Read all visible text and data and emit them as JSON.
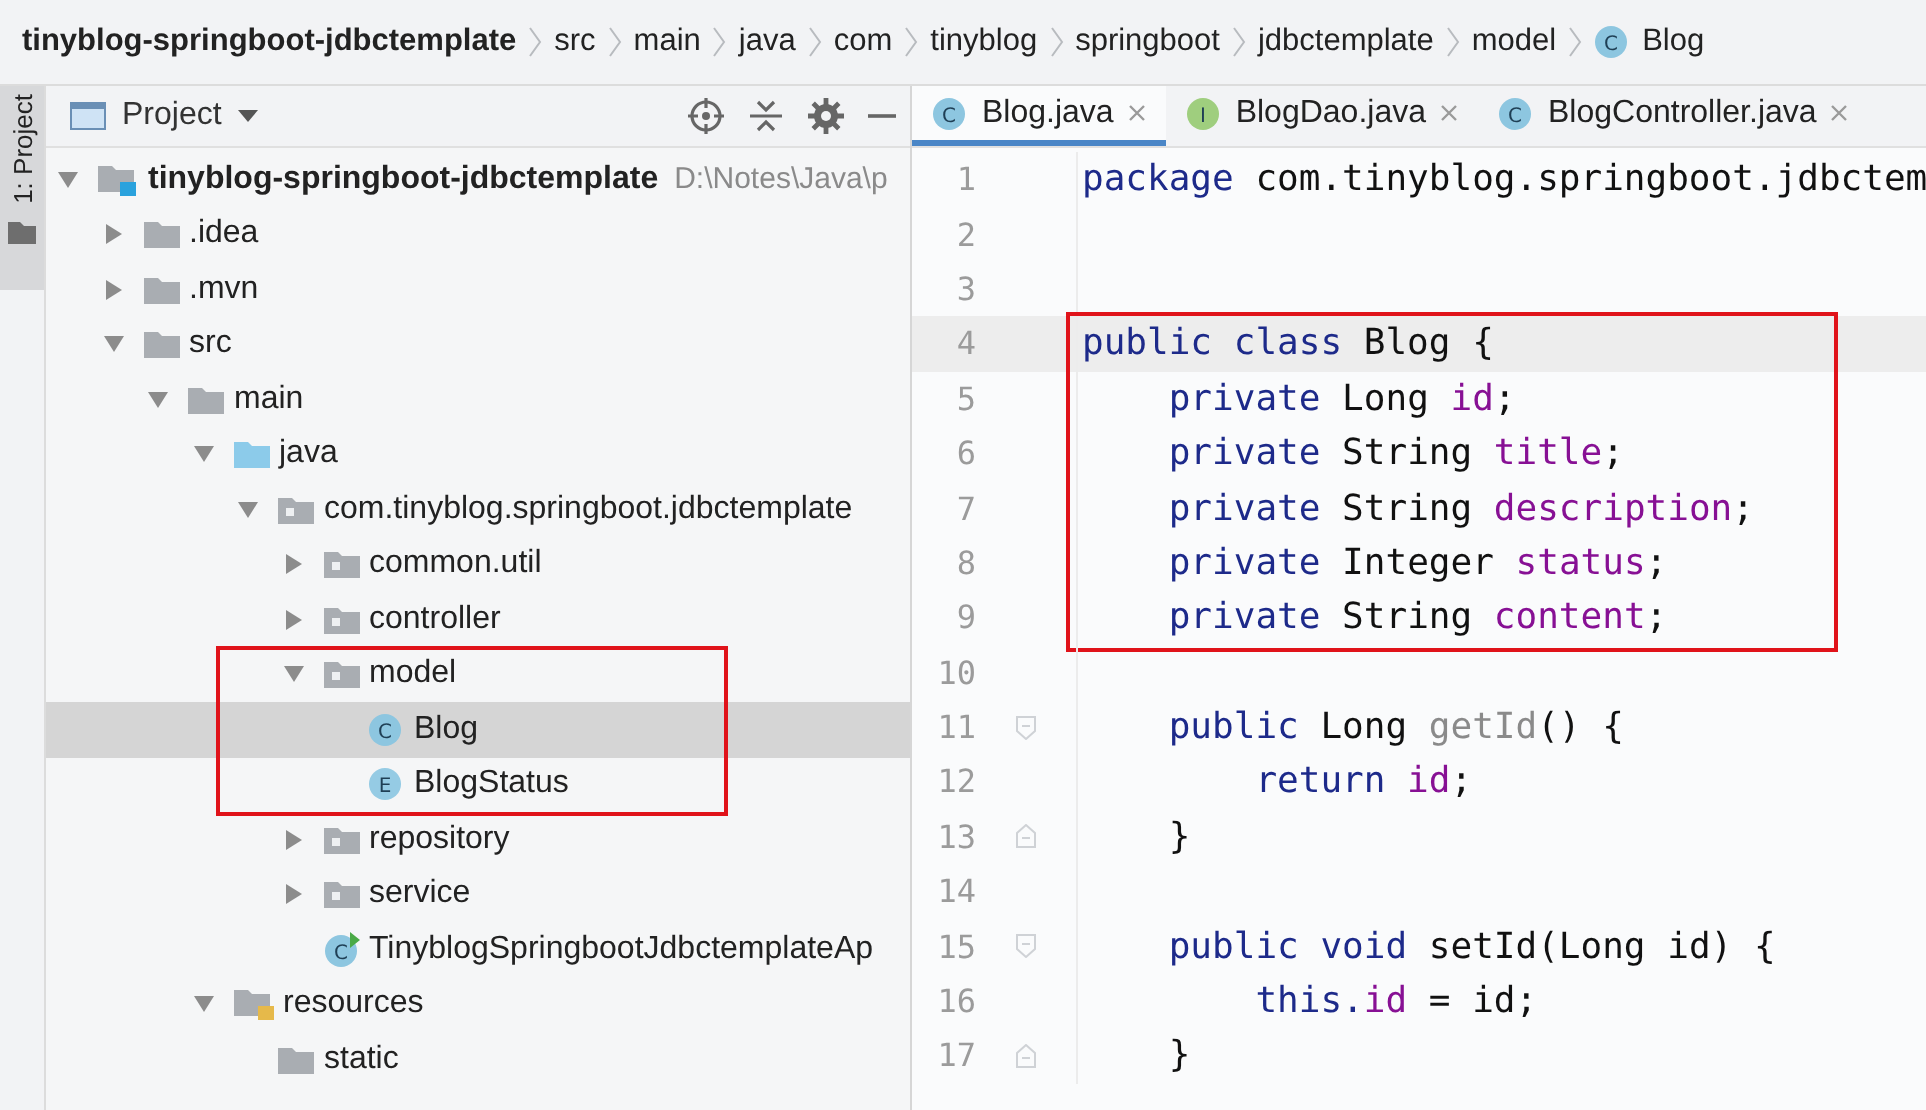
{
  "breadcrumb": [
    {
      "label": "tinyblog-springboot-jdbctemplate",
      "kind": "project"
    },
    {
      "label": "src",
      "kind": "folder"
    },
    {
      "label": "main",
      "kind": "folder"
    },
    {
      "label": "java",
      "kind": "folder"
    },
    {
      "label": "com",
      "kind": "folder"
    },
    {
      "label": "tinyblog",
      "kind": "folder"
    },
    {
      "label": "springboot",
      "kind": "folder"
    },
    {
      "label": "jdbctemplate",
      "kind": "folder"
    },
    {
      "label": "model",
      "kind": "folder"
    },
    {
      "label": "Blog",
      "kind": "class",
      "icon_letter": "C"
    }
  ],
  "side_strip": {
    "label": "1: Project",
    "selected": true
  },
  "project_panel": {
    "title": "Project",
    "tree": [
      {
        "label": "tinyblog-springboot-jdbctemplate",
        "path": "D:\\Notes\\Java\\p",
        "kind": "module",
        "expanded": true,
        "selected": false,
        "children": [
          {
            "label": ".idea",
            "kind": "folder",
            "expanded": false,
            "selected": false
          },
          {
            "label": ".mvn",
            "kind": "folder",
            "expanded": false,
            "selected": false
          },
          {
            "label": "src",
            "kind": "folder",
            "expanded": true,
            "selected": false,
            "children": [
              {
                "label": "main",
                "kind": "folder",
                "expanded": true,
                "selected": false,
                "children": [
                  {
                    "label": "java",
                    "kind": "source",
                    "expanded": true,
                    "selected": false,
                    "children": [
                      {
                        "label": "com.tinyblog.springboot.jdbctemplate",
                        "kind": "package",
                        "expanded": true,
                        "selected": false,
                        "children": [
                          {
                            "label": "common.util",
                            "kind": "package",
                            "expanded": false,
                            "selected": false
                          },
                          {
                            "label": "controller",
                            "kind": "package",
                            "expanded": false,
                            "selected": false
                          },
                          {
                            "label": "model",
                            "kind": "package",
                            "expanded": true,
                            "selected": false,
                            "boxed": true,
                            "children": [
                              {
                                "label": "Blog",
                                "kind": "class",
                                "icon_letter": "C",
                                "selected": true
                              },
                              {
                                "label": "BlogStatus",
                                "kind": "enum",
                                "icon_letter": "E",
                                "selected": false
                              }
                            ]
                          },
                          {
                            "label": "repository",
                            "kind": "package",
                            "expanded": false,
                            "selected": false
                          },
                          {
                            "label": "service",
                            "kind": "package",
                            "expanded": false,
                            "selected": false
                          },
                          {
                            "label": "TinyblogSpringbootJdbctemplateAp",
                            "kind": "app",
                            "icon_letter": "C",
                            "selected": false
                          }
                        ]
                      }
                    ]
                  },
                  {
                    "label": "resources",
                    "kind": "resources",
                    "expanded": true,
                    "selected": false,
                    "children": [
                      {
                        "label": "static",
                        "kind": "folder",
                        "selected": false
                      }
                    ]
                  }
                ]
              }
            ]
          }
        ]
      }
    ]
  },
  "editor": {
    "tabs": [
      {
        "label": "Blog.java",
        "kind": "class",
        "icon_letter": "C",
        "selected": true
      },
      {
        "label": "BlogDao.java",
        "kind": "interface",
        "icon_letter": "I",
        "selected": false
      },
      {
        "label": "BlogController.java",
        "kind": "class",
        "icon_letter": "C",
        "selected": false
      }
    ],
    "lines": [
      {
        "number": "1",
        "tokens": [
          {
            "kind": "keyword",
            "text": "package"
          },
          {
            "kind": "plain",
            "text": " com.tinyblog.springboot.jdbctem"
          }
        ]
      },
      {
        "number": "2"
      },
      {
        "number": "3"
      },
      {
        "number": "4",
        "current": true,
        "boxed": true,
        "tokens": [
          {
            "kind": "keyword",
            "text": "public class"
          },
          {
            "kind": "plain",
            "text": " Blog {"
          }
        ]
      },
      {
        "number": "5",
        "boxed": true,
        "tokens": [
          {
            "kind": "keyword",
            "text": "    private"
          },
          {
            "kind": "plain",
            "text": " Long "
          },
          {
            "kind": "field",
            "text": "id"
          },
          {
            "kind": "plain",
            "text": ";"
          }
        ]
      },
      {
        "number": "6",
        "boxed": true,
        "tokens": [
          {
            "kind": "keyword",
            "text": "    private"
          },
          {
            "kind": "plain",
            "text": " String "
          },
          {
            "kind": "field",
            "text": "title"
          },
          {
            "kind": "plain",
            "text": ";"
          }
        ]
      },
      {
        "number": "7",
        "boxed": true,
        "tokens": [
          {
            "kind": "keyword",
            "text": "    private"
          },
          {
            "kind": "plain",
            "text": " String "
          },
          {
            "kind": "field",
            "text": "description"
          },
          {
            "kind": "plain",
            "text": ";"
          }
        ]
      },
      {
        "number": "8",
        "boxed": true,
        "tokens": [
          {
            "kind": "keyword",
            "text": "    private"
          },
          {
            "kind": "plain",
            "text": " Integer "
          },
          {
            "kind": "field",
            "text": "status"
          },
          {
            "kind": "plain",
            "text": ";"
          }
        ]
      },
      {
        "number": "9",
        "boxed": true,
        "tokens": [
          {
            "kind": "keyword",
            "text": "    private"
          },
          {
            "kind": "plain",
            "text": " String "
          },
          {
            "kind": "field",
            "text": "content"
          },
          {
            "kind": "plain",
            "text": ";"
          }
        ]
      },
      {
        "number": "10"
      },
      {
        "number": "11",
        "fold_start": true,
        "tokens": [
          {
            "kind": "keyword",
            "text": "    public"
          },
          {
            "kind": "plain",
            "text": " Long "
          },
          {
            "kind": "method",
            "text": "getId"
          },
          {
            "kind": "plain",
            "text": "() {"
          }
        ]
      },
      {
        "number": "12",
        "tokens": [
          {
            "kind": "keyword",
            "text": "        return"
          },
          {
            "kind": "field",
            "text": " id"
          },
          {
            "kind": "plain",
            "text": ";"
          }
        ]
      },
      {
        "number": "13",
        "fold_end": true,
        "tokens": [
          {
            "kind": "plain",
            "text": "    }"
          }
        ]
      },
      {
        "number": "14"
      },
      {
        "number": "15",
        "fold_start": true,
        "tokens": [
          {
            "kind": "keyword",
            "text": "    public void"
          },
          {
            "kind": "plain",
            "text": " setId(Long id) {"
          }
        ]
      },
      {
        "number": "16",
        "tokens": [
          {
            "kind": "keyword",
            "text": "        this."
          },
          {
            "kind": "field",
            "text": "id"
          },
          {
            "kind": "plain",
            "text": " = id;"
          }
        ]
      },
      {
        "number": "17",
        "fold_end": true,
        "tokens": [
          {
            "kind": "plain",
            "text": "    }"
          }
        ]
      }
    ]
  }
}
